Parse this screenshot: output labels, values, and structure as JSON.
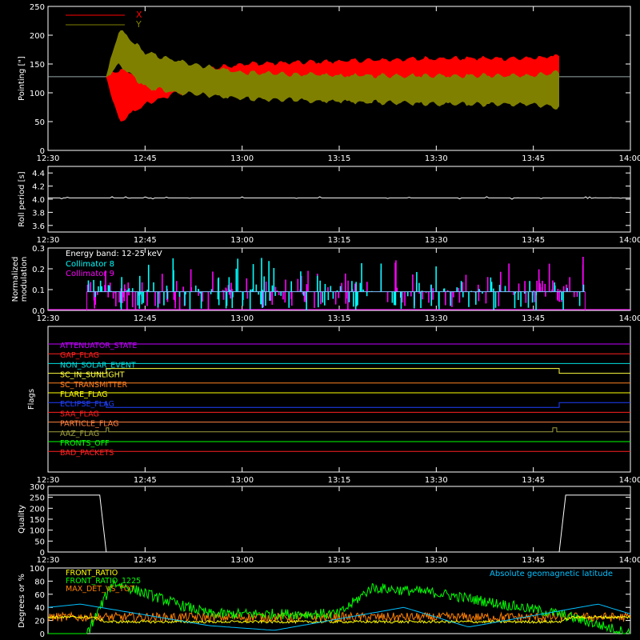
{
  "time_ticks": [
    "12:30",
    "12:45",
    "13:00",
    "13:15",
    "13:30",
    "13:45",
    "14:00"
  ],
  "time_range_min": [
    750,
    840
  ],
  "panels": {
    "pointing": {
      "ylabel": "Pointing [\"]",
      "yticks": [
        0,
        50,
        100,
        150,
        200,
        250
      ],
      "ylim": [
        0,
        250
      ],
      "legend": [
        {
          "label": "X",
          "color": "#ff0000"
        },
        {
          "label": "Y",
          "color": "#808000"
        }
      ]
    },
    "roll": {
      "ylabel": "Roll period [s]",
      "yticks": [
        "3.6",
        "3.8",
        "4.0",
        "4.2",
        "4.4"
      ],
      "ylim": [
        3.5,
        4.5
      ]
    },
    "modulation": {
      "ylabel_1": "Normalized",
      "ylabel_2": "modulation",
      "yticks": [
        "0.0",
        "0.1",
        "0.2",
        "0.3"
      ],
      "ylim": [
        0,
        0.3
      ],
      "annotation": "Energy band: 12-25 keV",
      "legend": [
        {
          "label": "Collimator 8",
          "color": "#00ffff"
        },
        {
          "label": "Collimator 9",
          "color": "#ff00ff"
        }
      ]
    },
    "flags": {
      "ylabel": "Flags",
      "items": [
        {
          "label": "ATTENUATOR_STATE",
          "color": "#c000ff"
        },
        {
          "label": "GAP_FLAG",
          "color": "#ff2020"
        },
        {
          "label": "NON_SOLAR_EVENT",
          "color": "#00e0e0"
        },
        {
          "label": "SC_IN_SUNLIGHT",
          "color": "#ffff40"
        },
        {
          "label": "SC_TRANSMITTER",
          "color": "#ff8020"
        },
        {
          "label": "FLARE_FLAG",
          "color": "#ffff00"
        },
        {
          "label": "ECLIPSE_FLAG",
          "color": "#2040ff"
        },
        {
          "label": "SAA_FLAG",
          "color": "#ff2020"
        },
        {
          "label": "PARTICLE_FLAG",
          "color": "#ff8040"
        },
        {
          "label": "AAZ_FLAG",
          "color": "#a0a040"
        },
        {
          "label": "FRONTS_OFF",
          "color": "#00ff00"
        },
        {
          "label": "BAD_PACKETS",
          "color": "#ff2020"
        }
      ]
    },
    "quality": {
      "ylabel": "Quality",
      "yticks": [
        0,
        50,
        100,
        150,
        200,
        250,
        300
      ],
      "ylim": [
        0,
        300
      ]
    },
    "ratios": {
      "ylabel": "Degrees or %",
      "yticks": [
        0,
        20,
        40,
        60,
        80,
        100
      ],
      "ylim": [
        0,
        100
      ],
      "legend": [
        {
          "label": "FRONT_RATIO",
          "color": "#ffff00"
        },
        {
          "label": "FRONT_RATIO_1225",
          "color": "#00ff00"
        },
        {
          "label": "MAX_DET_VS_TOT",
          "color": "#ff8000"
        }
      ],
      "annotation": "Absolute geomagnetic latitude",
      "annotation_color": "#00c0ff"
    }
  },
  "chart_data": [
    {
      "type": "line",
      "ylabel": "Pointing [\"]",
      "ylim": [
        0,
        250
      ],
      "xlim": [
        "12:20",
        "14:00"
      ],
      "series": [
        {
          "name": "X",
          "x": [
            "12:20",
            "12:39",
            "12:41",
            "12:45",
            "12:50",
            "13:00",
            "13:15",
            "13:30",
            "13:45",
            "13:49",
            "14:00"
          ],
          "y_min": [
            128,
            128,
            50,
            80,
            100,
            115,
            120,
            120,
            120,
            125,
            128
          ],
          "y_max": [
            128,
            128,
            140,
            130,
            135,
            150,
            155,
            160,
            160,
            165,
            128
          ]
        },
        {
          "name": "Y",
          "x": [
            "12:20",
            "12:39",
            "12:41",
            "12:45",
            "12:50",
            "13:00",
            "13:15",
            "13:30",
            "13:45",
            "13:49",
            "14:00"
          ],
          "y_min": [
            128,
            128,
            150,
            110,
            100,
            90,
            85,
            80,
            80,
            75,
            128
          ],
          "y_max": [
            128,
            128,
            210,
            170,
            155,
            135,
            130,
            130,
            130,
            135,
            128
          ]
        }
      ]
    },
    {
      "type": "line",
      "ylabel": "Roll period [s]",
      "ylim": [
        3.5,
        4.5
      ],
      "series": [
        {
          "x": [
            "12:20",
            "14:00"
          ],
          "y": [
            4.02,
            4.02
          ]
        }
      ]
    },
    {
      "type": "bar",
      "ylabel": "Normalized modulation",
      "ylim": [
        0,
        0.3
      ],
      "series": [
        {
          "name": "Collimator 8",
          "baseline": 0.09,
          "x_start": "12:36",
          "x_end": "13:53"
        },
        {
          "name": "Collimator 9",
          "baseline": 0.09,
          "x_start": "12:36",
          "x_end": "13:53"
        }
      ]
    },
    {
      "type": "line",
      "ylabel": "Flags",
      "series": [
        {
          "name": "SC_IN_SUNLIGHT",
          "x": [
            "12:20",
            "12:39",
            "12:39",
            "13:49",
            "13:49",
            "14:00"
          ],
          "y": [
            0,
            0,
            1,
            1,
            0,
            0
          ]
        },
        {
          "name": "ECLIPSE_FLAG",
          "x": [
            "12:20",
            "12:39",
            "12:39",
            "13:49",
            "13:49",
            "14:00"
          ],
          "y": [
            1,
            1,
            0,
            0,
            1,
            1
          ]
        },
        {
          "name": "AAZ_FLAG",
          "x": [
            "12:39",
            "12:40",
            "13:48",
            "13:49"
          ],
          "y": [
            1,
            1,
            1,
            1
          ]
        }
      ]
    },
    {
      "type": "line",
      "ylabel": "Quality",
      "ylim": [
        0,
        300
      ],
      "series": [
        {
          "x": [
            "12:20",
            "12:38",
            "12:39",
            "13:49",
            "13:50",
            "14:00"
          ],
          "y": [
            260,
            260,
            0,
            0,
            260,
            260
          ]
        }
      ]
    },
    {
      "type": "line",
      "ylabel": "Degrees or %",
      "ylim": [
        0,
        100
      ],
      "series": [
        {
          "name": "FRONT_RATIO",
          "x": [
            "12:20",
            "12:37",
            "12:39",
            "13:49",
            "13:51",
            "14:00"
          ],
          "y": [
            25,
            25,
            18,
            18,
            25,
            25
          ]
        },
        {
          "name": "FRONT_RATIO_1225",
          "x": [
            "12:20",
            "12:36",
            "12:40",
            "12:50",
            "12:55",
            "13:15",
            "13:20",
            "13:30",
            "13:49",
            "14:00"
          ],
          "y": [
            0,
            0,
            78,
            45,
            30,
            30,
            70,
            62,
            30,
            0
          ]
        },
        {
          "name": "MAX_DET_VS_TOT",
          "x": [
            "12:20",
            "14:00"
          ],
          "y": [
            25,
            25
          ]
        },
        {
          "name": "Absolute geomagnetic latitude",
          "x": [
            "12:20",
            "12:35",
            "12:55",
            "13:05",
            "13:25",
            "13:35",
            "13:55",
            "14:00"
          ],
          "y": [
            30,
            45,
            12,
            5,
            40,
            10,
            45,
            30
          ]
        }
      ]
    }
  ]
}
